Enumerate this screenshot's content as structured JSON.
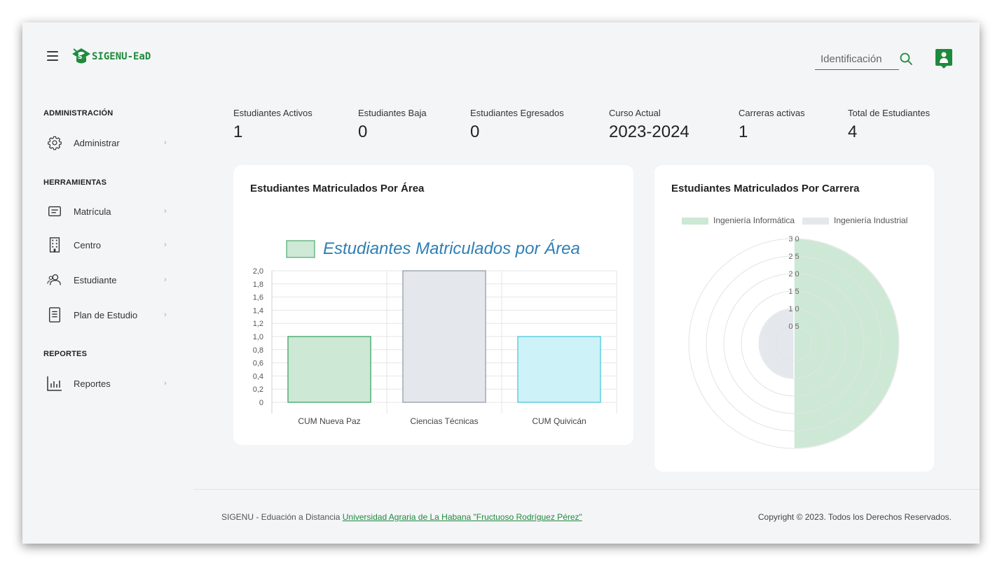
{
  "header": {
    "brand": "SIGENU-EaD",
    "search_placeholder": "Identificación"
  },
  "sidebar": {
    "sections": [
      {
        "title": "ADMINISTRACIÓN",
        "items": [
          {
            "label": "Administrar",
            "icon": "gear-icon"
          }
        ]
      },
      {
        "title": "HERRAMIENTAS",
        "items": [
          {
            "label": "Matrícula",
            "icon": "list-card-icon"
          },
          {
            "label": "Centro",
            "icon": "building-icon"
          },
          {
            "label": "Estudiante",
            "icon": "users-icon"
          },
          {
            "label": "Plan de Estudio",
            "icon": "book-icon"
          }
        ]
      },
      {
        "title": "REPORTES",
        "items": [
          {
            "label": "Reportes",
            "icon": "bar-chart-icon"
          }
        ]
      }
    ],
    "chevron": "›"
  },
  "stats": [
    {
      "label": "Estudiantes Activos",
      "value": "1"
    },
    {
      "label": "Estudiantes Baja",
      "value": "0"
    },
    {
      "label": "Estudiantes Egresados",
      "value": "0"
    },
    {
      "label": "Curso Actual",
      "value": "2023-2024"
    },
    {
      "label": "Carreras activas",
      "value": "1"
    },
    {
      "label": "Total de Estudiantes",
      "value": "4"
    }
  ],
  "area_card": {
    "title": "Estudiantes Matriculados Por Área"
  },
  "career_card": {
    "title": "Estudiantes Matriculados Por Carrera"
  },
  "chart_data": [
    {
      "type": "bar",
      "legend": [
        "Estudiantes Matriculados por Área"
      ],
      "categories": [
        "CUM Nueva Paz",
        "Ciencias Técnicas",
        "CUM Quivicán"
      ],
      "values": [
        1,
        2,
        1
      ],
      "ylim": [
        0,
        2
      ],
      "yticks": [
        "0",
        "0,2",
        "0,4",
        "0,6",
        "0,8",
        "1,0",
        "1,2",
        "1,4",
        "1,6",
        "1,8",
        "2,0"
      ],
      "colors": {
        "fill": [
          "#cde8d5",
          "#e4e7ec",
          "#cdf2f8"
        ],
        "stroke": [
          "#2e9e58",
          "#8d96a3",
          "#3fc5d6"
        ]
      },
      "legend_color": "#2f7fb4",
      "grid": true
    },
    {
      "type": "polarArea",
      "labels": [
        "Ingeniería Informática",
        "Ingeniería Industrial"
      ],
      "values": [
        3,
        1
      ],
      "rlim": [
        0,
        3
      ],
      "rticks": [
        "0 5",
        "1 0",
        "1 5",
        "2 0",
        "2 5",
        "3 0"
      ],
      "colors": {
        "fill": [
          "#cde8d5",
          "#e4e7ec"
        ]
      },
      "legend_position": "top"
    }
  ],
  "footer": {
    "left_text": "SIGENU - Eduación a Distancia ",
    "left_link": "Universidad Agraria de La Habana \"Fructuoso Rodríguez Pérez\"",
    "right_text": "Copyright © 2023. Todos los Derechos Reservados."
  }
}
